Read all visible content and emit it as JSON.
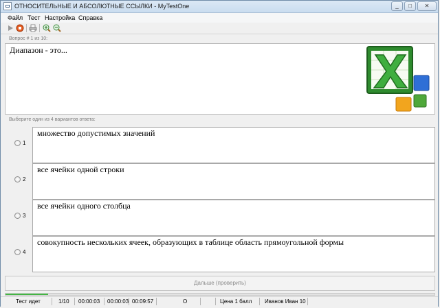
{
  "window": {
    "title": "ОТНОСИТЕЛЬНЫЕ И АБСОЛЮТНЫЕ ССЫЛКИ - MyTestOne",
    "app_icon": "window-app-icon",
    "controls": {
      "minimize": "_",
      "maximize": "□",
      "close": "✕"
    }
  },
  "menu": {
    "items": [
      {
        "label": "Файл"
      },
      {
        "label": "Тест"
      },
      {
        "label": "Настройка"
      },
      {
        "label": "Справка"
      }
    ]
  },
  "toolbar": {
    "icons": [
      "play-icon",
      "stop-icon",
      "print-icon",
      "zoom-in-icon",
      "zoom-out-icon"
    ]
  },
  "question": {
    "header": "Вопрос # 1 из 10:",
    "text": "Диапазон - это...",
    "image": "excel-logo-icon"
  },
  "answers": {
    "header": "Выберите один из 4 вариантов ответа:",
    "options": [
      {
        "number": "1",
        "text": "множество допустимых значений"
      },
      {
        "number": "2",
        "text": "все ячейки одной строки"
      },
      {
        "number": "3",
        "text": "все ячейки одного столбца"
      },
      {
        "number": "4",
        "text": "совокупность нескольких ячеек, образующих в таблице область прямоугольной формы"
      }
    ]
  },
  "next_button": {
    "label": "Дальше (проверить)"
  },
  "progress": {
    "fraction": 0.1,
    "color": "#3cb43c"
  },
  "status": {
    "state": "Тест идет",
    "question_count": "1/10",
    "time_1": "00:00:03",
    "time_2": "00:00:03",
    "time_3": "00:09:57",
    "mark": "O",
    "price": "Цена 1 балл",
    "user": "Иванов Иван 10"
  },
  "colors": {
    "accent": "#2fa62f",
    "titlebar": "#c9dcef"
  }
}
